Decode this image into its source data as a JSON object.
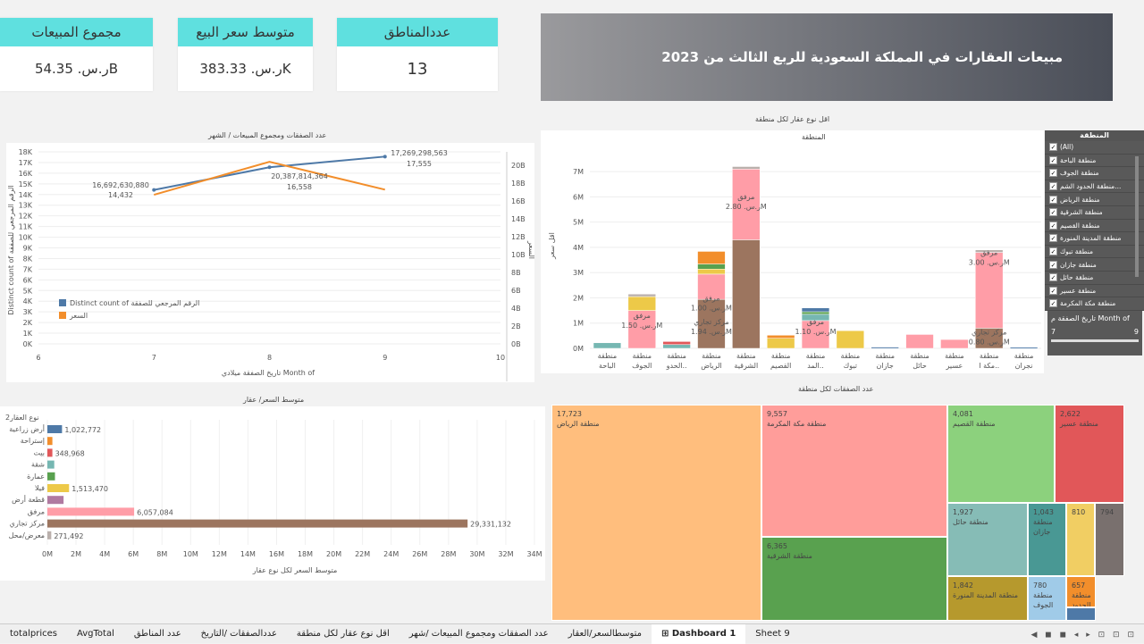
{
  "kpis": [
    {
      "label": "مجموع المبيعات",
      "value": "ر.س. 54.35B"
    },
    {
      "label": "متوسط سعر البيع",
      "value": "ر.س. 383.33K"
    },
    {
      "label": "عددالمناطق",
      "value": "13"
    }
  ],
  "dashboard_title": "مبيعات العقارات في المملكة السعودية للربع الثالث من 2023",
  "line_chart": {
    "title": "عدد الصفقات ومجموع المبيعات / الشهر",
    "xlabel": "تاريخ الصفقة ميلادي Month of",
    "ylabel": "Distinct count of الرقم المرجعي للصفقة",
    "y2label": "السعر",
    "legend": [
      {
        "name": "Distinct count of الرقم المرجعي للصفقة",
        "color": "#4e79a7"
      },
      {
        "name": "السعر",
        "color": "#f28e2b"
      }
    ],
    "annotations": [
      "16,692,630,880",
      "14,432",
      "20,387,814,364",
      "16,558",
      "17,269,298,563",
      "17,555"
    ],
    "yticks": [
      "18K",
      "17K",
      "16K",
      "15K",
      "14K",
      "13K",
      "12K",
      "11K",
      "10K",
      "9K",
      "8K",
      "7K",
      "6K",
      "5K",
      "4K",
      "3K",
      "2K",
      "1K",
      "0K"
    ],
    "y2ticks": [
      "20B",
      "18B",
      "16B",
      "14B",
      "12B",
      "10B",
      "8B",
      "6B",
      "4B",
      "2B",
      "0B"
    ],
    "xticks": [
      "6",
      "7",
      "8",
      "9",
      "10"
    ]
  },
  "stacked_chart": {
    "outer_title": "اقل نوع عقار لكل منطقة",
    "inner_title": "المنطقة",
    "ylabel": "اقل سعر",
    "yticks": [
      "7M",
      "6M",
      "5M",
      "4M",
      "3M",
      "2M",
      "1M",
      "0M"
    ],
    "regions": [
      "منطقة الباحة",
      "منطقة الجوف",
      "منطقة الحدو..",
      "منطقة الرياض",
      "منطقة الشرقية",
      "منطقة القصيم",
      "منطقة المد..",
      "منطقة تبوك",
      "منطقة جازان",
      "منطقة حائل",
      "منطقة عسير",
      "منطقة مكة ا..",
      "منطقة نجران"
    ],
    "labels": [
      {
        "text": "مرفق",
        "sub": "ر.س. 1.50M"
      },
      {
        "text": "مرفق",
        "sub": "ر.س. 1.00M"
      },
      {
        "text": "مركز تجاري",
        "sub": "ر.س. 1.94M"
      },
      {
        "text": "مرفق",
        "sub": "ر.س. 2.80M"
      },
      {
        "text": "مرفق",
        "sub": "ر.س. 1.10M"
      },
      {
        "text": "مرفق",
        "sub": "ر.س. 3.00M"
      },
      {
        "text": "مركز تجاري",
        "sub": "ر.س. 0.80M"
      }
    ]
  },
  "filter": {
    "title": "المنطقة",
    "items": [
      "(All)",
      "منطقة الباحة",
      "منطقة الجوف",
      "منطقة الحدود الشم...",
      "منطقة الرياض",
      "منطقة الشرقية",
      "منطقة القصيم",
      "منطقة المدينة المنورة",
      "منطقة تبوك",
      "منطقة جازان",
      "منطقة حائل",
      "منطقة عسير",
      "منطقة مكة المكرمة"
    ],
    "date_title": "تاريخ الصفقة م Month of",
    "date_min": "7",
    "date_max": "9"
  },
  "bar_chart": {
    "title": "متوسط السعر/ عقار",
    "header": "نوع العقار2",
    "xlabel": "متوسط السعر لكل نوع عقار",
    "xticks": [
      "0M",
      "2M",
      "4M",
      "6M",
      "8M",
      "10M",
      "12M",
      "14M",
      "16M",
      "18M",
      "20M",
      "22M",
      "24M",
      "26M",
      "28M",
      "30M",
      "32M",
      "34M"
    ]
  },
  "chart_data": [
    {
      "type": "line",
      "x": [
        7,
        8,
        9
      ],
      "series": [
        {
          "name": "Distinct count of الرقم المرجعي للصفقة",
          "values": [
            14432,
            16558,
            17555
          ]
        },
        {
          "name": "السعر",
          "values": [
            16692630880,
            20387814364,
            17269298563
          ]
        }
      ],
      "ylim": [
        0,
        18000
      ],
      "y2lim": [
        0,
        20000000000
      ],
      "xlim": [
        6,
        10
      ]
    },
    {
      "type": "bar",
      "categories": [
        "أرض زراعية",
        "إستراحة",
        "بيت",
        "شقة",
        "عمارة",
        "فيلا",
        "قطعة أرض",
        "مرفق",
        "مركز تجاري",
        "معرض/محل"
      ],
      "values": [
        1022772,
        350000,
        348968,
        480000,
        530000,
        1513470,
        1130000,
        6057084,
        29331132,
        271492
      ],
      "value_labels": [
        "1,022,772",
        "",
        "348,968",
        "",
        "",
        "1,513,470",
        "",
        "6,057,084",
        "29,331,132",
        "271,492"
      ],
      "colors": [
        "#4e79a7",
        "#f28e2b",
        "#e15759",
        "#76b7b2",
        "#59a14f",
        "#edc948",
        "#b07aa1",
        "#ff9da7",
        "#9c755f",
        "#bab0ac"
      ],
      "xlim": [
        0,
        34000000
      ]
    },
    {
      "type": "bar",
      "stacked": true,
      "categories": [
        "منطقة الباحة",
        "منطقة الجوف",
        "منطقة الحدو..",
        "منطقة الرياض",
        "منطقة الشرقية",
        "منطقة القصيم",
        "منطقة المد..",
        "منطقة تبوك",
        "منطقة جازان",
        "منطقة حائل",
        "منطقة عسير",
        "منطقة مكة ا..",
        "منطقة نجران"
      ],
      "segments": [
        [
          {
            "c": "#76b7b2",
            "v": 0.22
          }
        ],
        [
          {
            "c": "#ff9da7",
            "v": 1.5
          },
          {
            "c": "#edc948",
            "v": 0.55
          },
          {
            "c": "#bab0ac",
            "v": 0.1
          }
        ],
        [
          {
            "c": "#76b7b2",
            "v": 0.15
          },
          {
            "c": "#e15759",
            "v": 0.12
          }
        ],
        [
          {
            "c": "#9c755f",
            "v": 1.94
          },
          {
            "c": "#ff9da7",
            "v": 1.0
          },
          {
            "c": "#edc948",
            "v": 0.2
          },
          {
            "c": "#59a14f",
            "v": 0.2
          },
          {
            "c": "#f28e2b",
            "v": 0.5
          }
        ],
        [
          {
            "c": "#9c755f",
            "v": 4.3
          },
          {
            "c": "#ff9da7",
            "v": 2.8
          },
          {
            "c": "#bab0ac",
            "v": 0.1
          }
        ],
        [
          {
            "c": "#edc948",
            "v": 0.4
          },
          {
            "c": "#f28e2b",
            "v": 0.12
          }
        ],
        [
          {
            "c": "#ff9da7",
            "v": 1.1
          },
          {
            "c": "#76b7b2",
            "v": 0.25
          },
          {
            "c": "#59a14f",
            "v": 0.1
          },
          {
            "c": "#4e79a7",
            "v": 0.15
          }
        ],
        [
          {
            "c": "#edc948",
            "v": 0.7
          }
        ],
        [
          {
            "c": "#4e79a7",
            "v": 0.05
          }
        ],
        [
          {
            "c": "#ff9da7",
            "v": 0.55
          }
        ],
        [
          {
            "c": "#ff9da7",
            "v": 0.35
          }
        ],
        [
          {
            "c": "#9c755f",
            "v": 0.8
          },
          {
            "c": "#ff9da7",
            "v": 3.0
          },
          {
            "c": "#bab0ac",
            "v": 0.1
          }
        ],
        [
          {
            "c": "#4e79a7",
            "v": 0.04
          }
        ]
      ],
      "ylim": [
        0,
        7500000
      ]
    },
    {
      "type": "heatmap",
      "title": "عدد الصفقات لكل منطقة",
      "cells": [
        {
          "value": "17,723",
          "label": "منطقة الرياض",
          "color": "#ffbe7d"
        },
        {
          "value": "9,557",
          "label": "منطقة مكة المكرمة",
          "color": "#ff9d9a"
        },
        {
          "value": "6,365",
          "label": "منطقة الشرقية",
          "color": "#59a14f"
        },
        {
          "value": "4,081",
          "label": "منطقة القصيم",
          "color": "#8cd17d"
        },
        {
          "value": "2,622",
          "label": "منطقة عسير",
          "color": "#e15759"
        },
        {
          "value": "1,927",
          "label": "منطقة حائل",
          "color": "#86bcb6"
        },
        {
          "value": "1,842",
          "label": "منطقة المدينة المنورة",
          "color": "#b6992d"
        },
        {
          "value": "1,043",
          "label": "منطقة جازان",
          "color": "#499894"
        },
        {
          "value": "810",
          "label": "",
          "color": "#f1ce63"
        },
        {
          "value": "794",
          "label": "",
          "color": "#79706e"
        },
        {
          "value": "780",
          "label": "منطقة الجوف",
          "color": "#a0cbe8"
        },
        {
          "value": "657",
          "label": "منطقة الحدود",
          "color": "#f28e2b"
        },
        {
          "value": "",
          "label": "",
          "color": "#4e79a7"
        }
      ]
    }
  ],
  "tabs": [
    "totalprices",
    "AvgTotal",
    "عدد المناطق",
    "عددالصفقات /التاريخ",
    "اقل نوع عقار لكل منطقة",
    "عدد الصفقات ومجموع المبيعات /شهر",
    "متوسطالسعر/العقار",
    "Dashboard 1",
    "Sheet 9"
  ],
  "active_tab": "Dashboard 1"
}
